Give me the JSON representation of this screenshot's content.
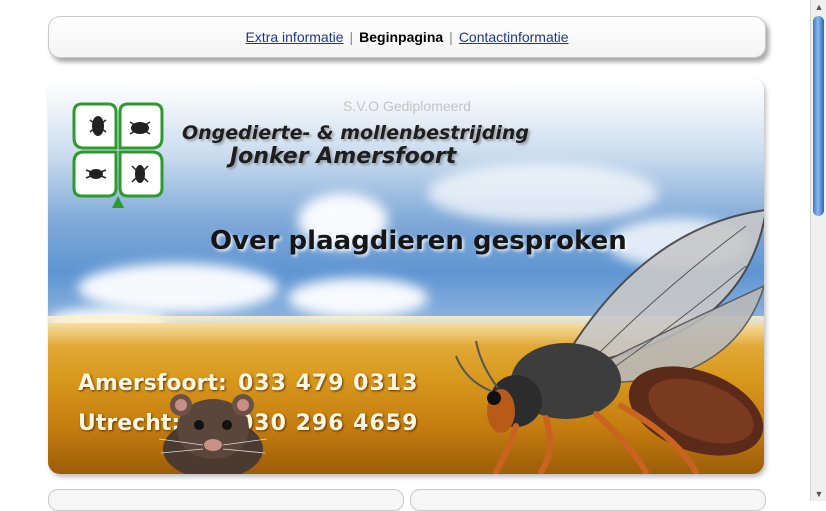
{
  "nav": {
    "link_extra": "Extra informatie",
    "current": "Beginpagina",
    "link_contact": "Contactinformatie",
    "separator": "|"
  },
  "banner": {
    "certification": "S.V.O Gediplomeerd",
    "company_line1": "Ongedierte- & mollenbestrijding",
    "company_line2": "Jonker Amersfoort",
    "tagline": "Over plaagdieren gesproken",
    "phones": [
      {
        "city": "Amersfoort:",
        "number": "033 479 0313"
      },
      {
        "city": "Utrecht:",
        "number": "030 296 4659"
      }
    ]
  },
  "colors": {
    "link": "#1a3a8a",
    "logo_green": "#2e9a2e",
    "sky_blue": "#5f95d2",
    "field_gold": "#d99a1e",
    "scroll_thumb": "#3a78c9"
  },
  "icons": {
    "logo": "clover-insect-logo",
    "mole": "mole-image",
    "wasp": "wasp-image",
    "scroll_up": "arrow-up-icon",
    "scroll_down": "arrow-down-icon"
  }
}
